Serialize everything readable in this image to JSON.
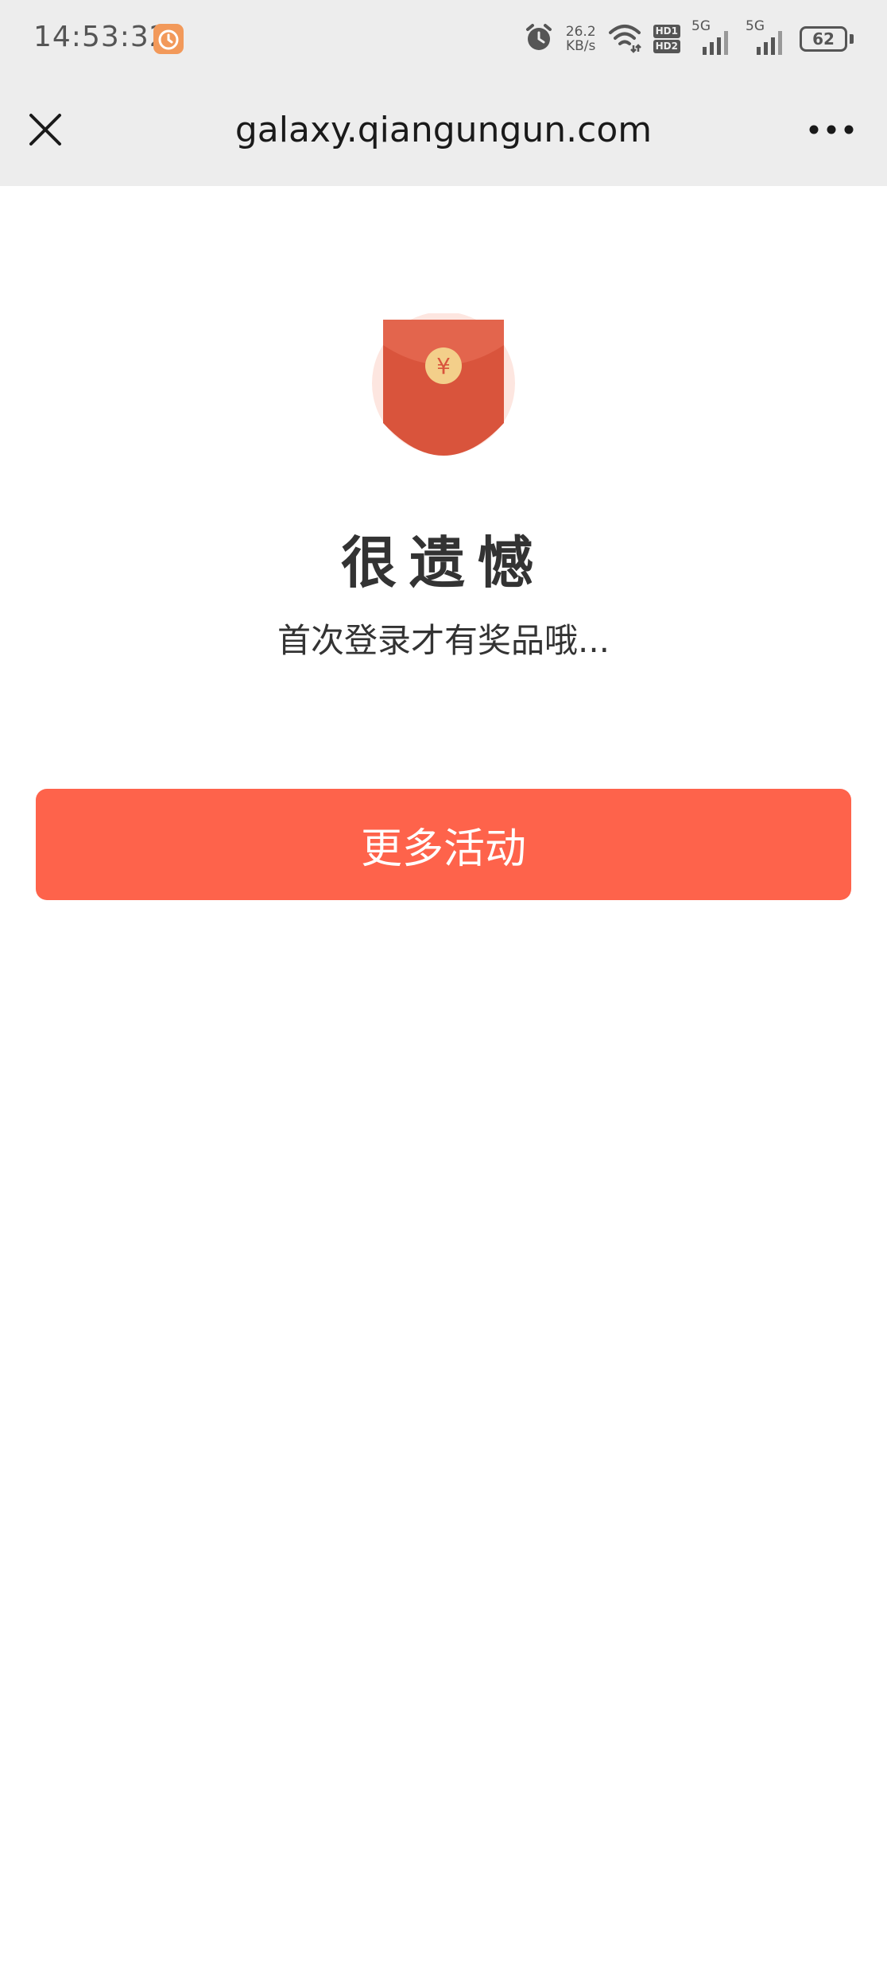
{
  "status_bar": {
    "time": "14:53:32",
    "speed_value": "26.2",
    "speed_unit": "KB/s",
    "hd1": "HD1",
    "hd2": "HD2",
    "sim1_label": "5G",
    "sim2_label": "5G",
    "battery": "62",
    "alarm_icon": "alarm-clock-icon",
    "app_icon": "orange-clock-app-icon",
    "wifi_icon": "wifi-icon"
  },
  "nav": {
    "title": "galaxy.qiangungun.com",
    "close_icon": "close-icon",
    "more_icon": "more-dots-icon"
  },
  "content": {
    "envelope_icon": "red-envelope-icon",
    "coin_symbol": "¥",
    "headline": "很遗憾",
    "message": "首次登录才有奖品哦...",
    "button_label": "更多活动"
  },
  "colors": {
    "accent": "#fe634b",
    "envelope": "#d9543c",
    "coin": "#f3cf8a",
    "topbar": "#ededed"
  }
}
